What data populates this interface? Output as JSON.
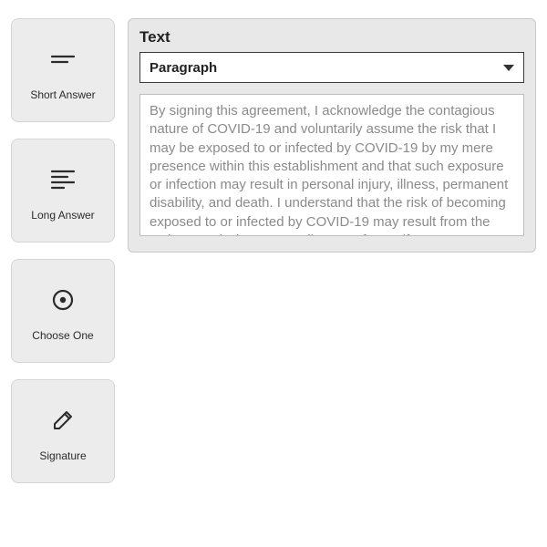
{
  "sidebar": {
    "short_answer": {
      "label": "Short Answer"
    },
    "long_answer": {
      "label": "Long Answer"
    },
    "choose_one": {
      "label": "Choose One"
    },
    "signature": {
      "label": "Signature"
    }
  },
  "panel": {
    "title": "Text",
    "type_select": {
      "value": "Paragraph"
    },
    "body": "By signing this agreement, I acknowledge the contagious nature of COVID-19 and voluntarily assume the risk that I may be exposed to or infected by COVID-19 by my mere presence within this establishment and that such exposure or infection may result in personal injury, illness, permanent disability, and death. I understand that the risk of becoming exposed to or infected by COVID-19 may result from the actions, omissions, or negligence of myself"
  }
}
